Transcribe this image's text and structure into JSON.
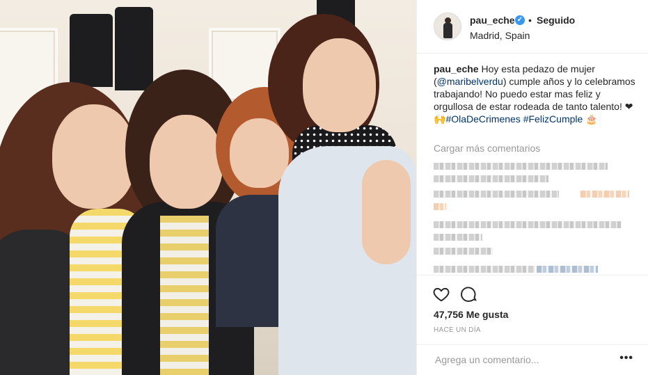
{
  "post": {
    "username": "pau_eche",
    "follow_separator": "•",
    "follow_status": "Seguido",
    "location": "Madrid, Spain",
    "verified_icon": "✓",
    "caption": {
      "author": "pau_eche",
      "part1": " Hoy esta pedazo de mujer (",
      "mention": "@maribelverdu",
      "part2": ") cumple años y lo celebramos trabajando! No puedo estar mas feliz y orgullosa de estar rodeada de tanto talento! ❤🙌",
      "hashtag1": "#OlaDeCrimenes",
      "hashtag2": "#FelizCumple",
      "emoji_end": " 🎂"
    },
    "load_more": "Cargar más comentarios",
    "likes": "47,756 Me gusta",
    "time_ago": "HACE UN DÍA",
    "comment_placeholder": "Agrega un comentario...",
    "more_options": "•••"
  },
  "colors": {
    "link": "#003569",
    "muted": "#999999",
    "verified": "#3897f0",
    "text": "#262626"
  },
  "icons": {
    "like": "heart-icon",
    "comment": "comment-icon",
    "verified": "verified-badge-icon",
    "more": "more-options-icon"
  }
}
